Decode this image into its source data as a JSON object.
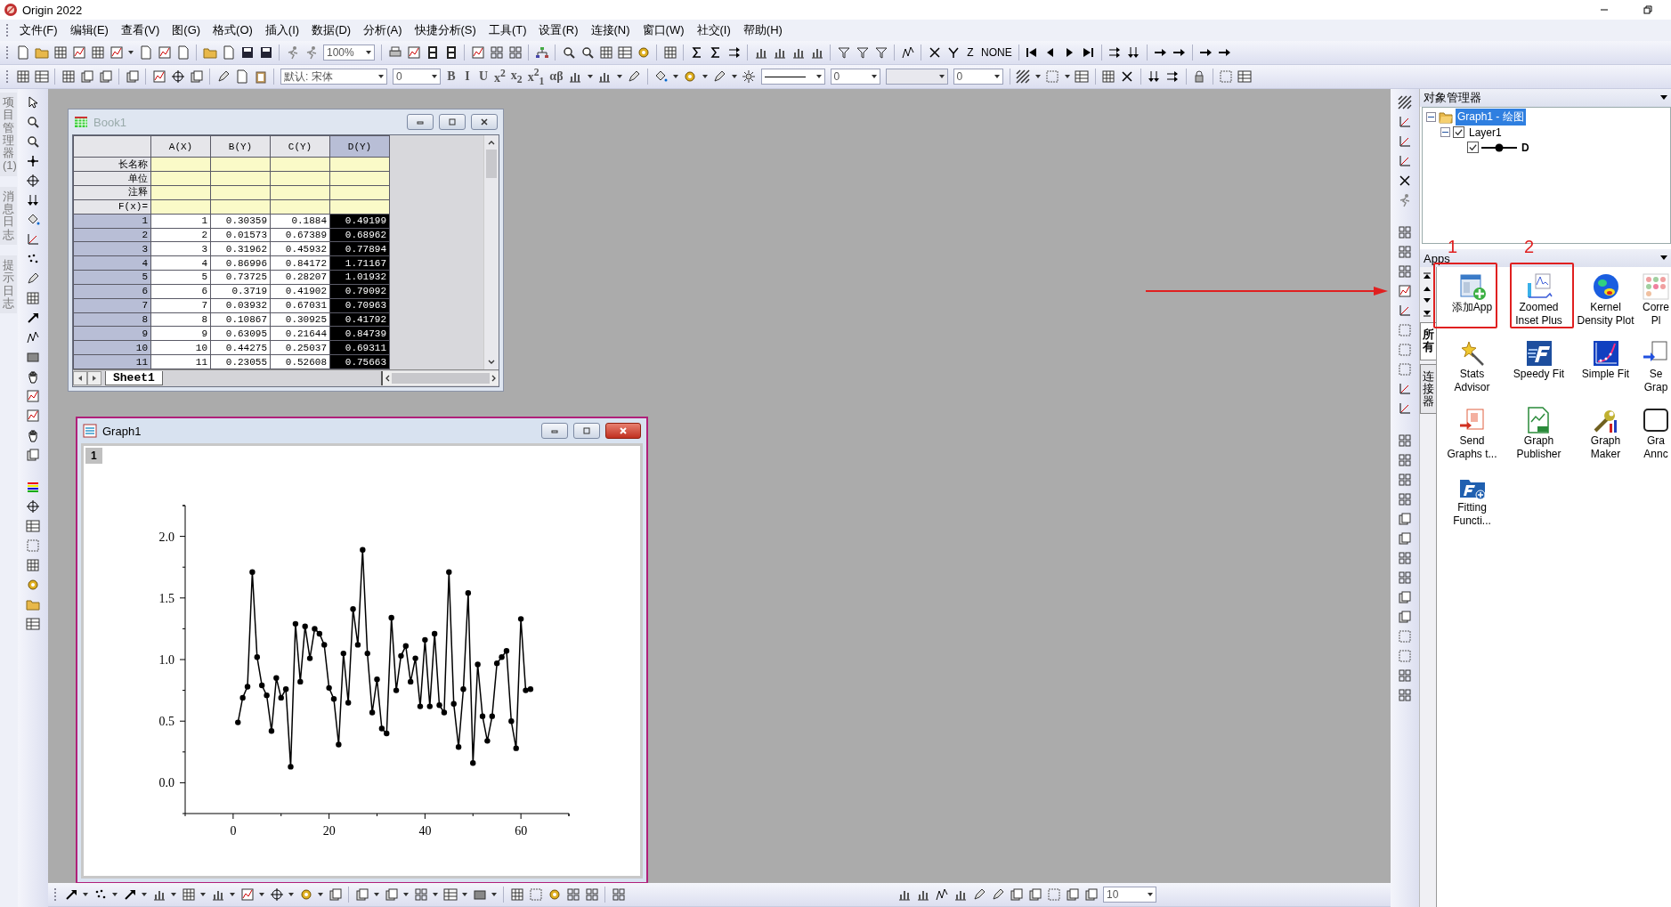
{
  "window": {
    "title": "Origin 2022"
  },
  "menu": [
    "文件(F)",
    "编辑(E)",
    "查看(V)",
    "图(G)",
    "格式(O)",
    "插入(I)",
    "数据(D)",
    "分析(A)",
    "快捷分析(S)",
    "工具(T)",
    "设置(R)",
    "连接(N)",
    "窗口(W)",
    "社交(I)",
    "帮助(H)"
  ],
  "toolbar_1": {
    "zoom_field": "100%",
    "z_button": "Z",
    "none_button": "NONE"
  },
  "toolbar_2": {
    "font_field": "默认: 宋体",
    "size_field": "0",
    "format_buttons": [
      "B",
      "I",
      "U",
      "x$^{2}$",
      "x$_{2}$",
      "x$^{2}$$_{1}$",
      "αβ"
    ],
    "fields": [
      "0",
      "0"
    ]
  },
  "side_tabs": [
    "项目管理器 (1)",
    "消息日志",
    "提示日志"
  ],
  "book": {
    "title": "Book1",
    "columns": [
      {
        "label": "A(X)",
        "selected": false
      },
      {
        "label": "B(Y)",
        "selected": false
      },
      {
        "label": "C(Y)",
        "selected": false
      },
      {
        "label": "D(Y)",
        "selected": true
      }
    ],
    "label_rows": [
      "长名称",
      "单位",
      "注释",
      "F(x)="
    ],
    "row_numbers": [
      "1",
      "2",
      "3",
      "4",
      "5",
      "6",
      "7",
      "8",
      "9",
      "10",
      "11"
    ],
    "rows": [
      [
        "1",
        "0.30359",
        "0.1884",
        "0.49199"
      ],
      [
        "2",
        "0.01573",
        "0.67389",
        "0.68962"
      ],
      [
        "3",
        "0.31962",
        "0.45932",
        "0.77894"
      ],
      [
        "4",
        "0.86996",
        "0.84172",
        "1.71167"
      ],
      [
        "5",
        "0.73725",
        "0.28207",
        "1.01932"
      ],
      [
        "6",
        "0.3719",
        "0.41902",
        "0.79092"
      ],
      [
        "7",
        "0.03932",
        "0.67031",
        "0.70963"
      ],
      [
        "8",
        "0.10867",
        "0.30925",
        "0.41792"
      ],
      [
        "9",
        "0.63095",
        "0.21644",
        "0.84739"
      ],
      [
        "10",
        "0.44275",
        "0.25037",
        "0.69311"
      ],
      [
        "11",
        "0.23055",
        "0.52608",
        "0.75663"
      ]
    ],
    "sheet_tab": "Sheet1"
  },
  "graph": {
    "title": "Graph1",
    "layer": "1",
    "chart_data": {
      "type": "line",
      "x": [
        1,
        2,
        3,
        4,
        5,
        6,
        7,
        8,
        9,
        10,
        11,
        12,
        13,
        14,
        15,
        16,
        17,
        18,
        19,
        20,
        21,
        22,
        23,
        24,
        25,
        26,
        27,
        28,
        29,
        30,
        31,
        32,
        33,
        34,
        35,
        36,
        37,
        38,
        39,
        40,
        41,
        42,
        43,
        44,
        45,
        46,
        47,
        48,
        49,
        50,
        51,
        52,
        53,
        54,
        55,
        56,
        57,
        58,
        59,
        60,
        61,
        62
      ],
      "series": [
        {
          "color": "#000000",
          "marker": "circle",
          "values": [
            0.49,
            0.69,
            0.78,
            1.71,
            1.02,
            0.79,
            0.71,
            0.42,
            0.85,
            0.69,
            0.76,
            0.13,
            1.29,
            0.82,
            1.27,
            1.01,
            1.25,
            1.21,
            1.12,
            0.77,
            0.68,
            0.31,
            1.05,
            0.65,
            1.41,
            1.12,
            1.89,
            1.05,
            0.57,
            0.84,
            0.44,
            0.4,
            1.34,
            0.75,
            1.03,
            1.11,
            0.82,
            1.01,
            0.62,
            1.16,
            0.62,
            1.21,
            0.63,
            0.57,
            1.71,
            0.64,
            0.29,
            0.76,
            1.54,
            0.16,
            0.96,
            0.54,
            0.34,
            0.54,
            0.97,
            1.02,
            1.07,
            0.5,
            0.28,
            1.33,
            0.75,
            0.76
          ]
        }
      ],
      "xlim": [
        -10,
        70
      ],
      "ylim": [
        -0.25,
        2.25
      ],
      "xticks": [
        0,
        20,
        40,
        60
      ],
      "yticks": [
        {
          "value": 0,
          "label": "0.0"
        },
        {
          "value": 0.5,
          "label": "0.5"
        },
        {
          "value": 1,
          "label": "1.0"
        },
        {
          "value": 1.5,
          "label": "1.5"
        },
        {
          "value": 2,
          "label": "2.0"
        }
      ]
    }
  },
  "object_manager": {
    "title": "对象管理器",
    "tree": [
      {
        "label": "Graph1 - 绘图",
        "kind": "graph",
        "selected": true,
        "expanded": true,
        "children": [
          {
            "label": "Layer1",
            "selected": false,
            "checked": true,
            "expanded": true,
            "children": [
              {
                "label": "D",
                "kind": "plot",
                "selected": false,
                "checked": true
              }
            ]
          }
        ]
      }
    ]
  },
  "apps": {
    "title": "Apps",
    "tabs": [
      {
        "label": "所有",
        "selected": true
      },
      {
        "label": "连接器",
        "selected": false
      }
    ],
    "items": [
      {
        "lines": [
          "添加App"
        ]
      },
      {
        "lines": [
          "Zoomed",
          "Inset Plus"
        ]
      },
      {
        "lines": [
          "Kernel",
          "Density Plot"
        ]
      },
      {
        "lines": [
          "Corre",
          "Pl"
        ]
      },
      {
        "lines": [
          "Stats",
          "Advisor"
        ]
      },
      {
        "lines": [
          "Speedy Fit"
        ]
      },
      {
        "lines": [
          "Simple Fit"
        ]
      },
      {
        "lines": [
          "Se",
          "Grap"
        ]
      },
      {
        "lines": [
          "Send",
          "Graphs t..."
        ]
      },
      {
        "lines": [
          "Graph",
          "Publisher"
        ]
      },
      {
        "lines": [
          "Graph",
          "Maker"
        ]
      },
      {
        "lines": [
          "Gra",
          "Annc"
        ]
      },
      {
        "lines": [
          "Fitting",
          "Functi..."
        ]
      }
    ]
  },
  "annotations": {
    "marks": [
      "1",
      "2"
    ]
  },
  "bottom_toolbar": {
    "field": "10"
  }
}
